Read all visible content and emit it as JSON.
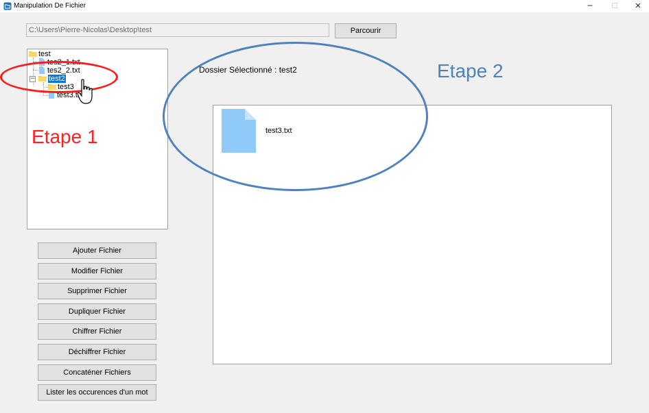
{
  "window": {
    "title": "Manipulation De Fichier",
    "minimize_glyph": "─",
    "maximize_glyph": "☐",
    "close_glyph": "✕"
  },
  "path_bar": {
    "value": "C:\\Users\\Pierre-Nicolas\\Desktop\\test",
    "browse_label": "Parcourir"
  },
  "tree": {
    "root": "test",
    "items": [
      {
        "label": "tes2_1.txt",
        "type": "file"
      },
      {
        "label": "tes2_2.txt",
        "type": "file"
      },
      {
        "label": "test2",
        "type": "folder",
        "expanded": true,
        "selected": true
      },
      {
        "label": "test3",
        "type": "folder"
      },
      {
        "label": "test3.txt",
        "type": "file"
      }
    ],
    "collapse_glyph": "−"
  },
  "annotations": {
    "step1": "Etape 1",
    "step2": "Etape 2",
    "step1_color": "#ff2020",
    "step2_color": "#4f81bd"
  },
  "selection": {
    "label": "Dossier Sélectionné : test2"
  },
  "content": {
    "files": [
      {
        "label": "test3.txt",
        "icon": "file-icon"
      }
    ]
  },
  "actions": [
    "Ajouter Fichier",
    "Modifier Fichier",
    "Supprimer Fichier",
    "Dupliquer Fichier",
    "Chiffrer Fichier",
    "Déchiffrer Fichier",
    "Concaténer Fichiers",
    "Lister les occurences d'un mot"
  ],
  "colors": {
    "folder": "#ffc83d",
    "file": "#90caf9",
    "selection": "#0078d7"
  }
}
